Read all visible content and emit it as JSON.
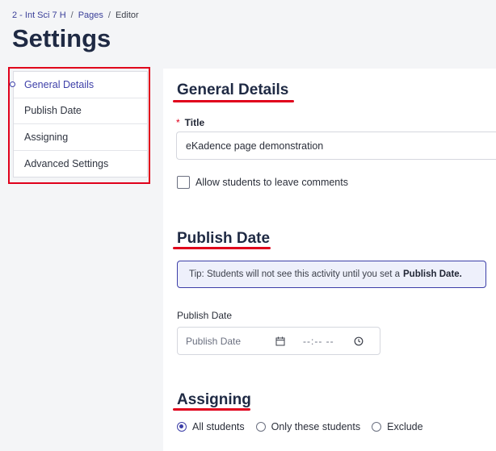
{
  "breadcrumb": {
    "course": "2 - Int Sci 7 H",
    "sep": "/",
    "pages": "Pages",
    "current": "Editor"
  },
  "page_title": "Settings",
  "sidebar": {
    "items": [
      {
        "label": "General Details",
        "active": true
      },
      {
        "label": "Publish Date"
      },
      {
        "label": "Assigning"
      },
      {
        "label": "Advanced Settings"
      }
    ]
  },
  "general": {
    "heading": "General Details",
    "title_label": "Title",
    "required_mark": "*",
    "title_value": "eKadence page demonstration",
    "comments_label": "Allow students to leave comments"
  },
  "publish": {
    "heading": "Publish Date",
    "tip_prefix": "Tip: Students will not see this activity until you set a",
    "tip_bold": "Publish Date.",
    "field_label": "Publish Date",
    "date_placeholder": "Publish Date",
    "time_placeholder": "--:-- --"
  },
  "assigning": {
    "heading": "Assigning",
    "options": [
      {
        "label": "All students",
        "checked": true
      },
      {
        "label": "Only these students"
      },
      {
        "label": "Exclude"
      }
    ]
  },
  "colors": {
    "accent": "#3d3fa8",
    "annotation": "#e0001b"
  }
}
